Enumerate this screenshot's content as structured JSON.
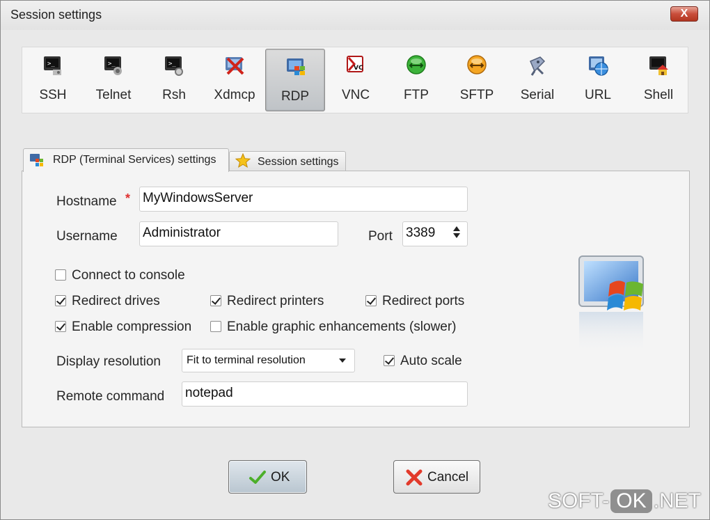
{
  "window": {
    "title": "Session settings",
    "close_label": "X"
  },
  "session_types": [
    {
      "label": "SSH",
      "icon": "ssh-terminal-icon"
    },
    {
      "label": "Telnet",
      "icon": "telnet-terminal-icon"
    },
    {
      "label": "Rsh",
      "icon": "rsh-terminal-icon"
    },
    {
      "label": "Xdmcp",
      "icon": "xdmcp-icon"
    },
    {
      "label": "RDP",
      "icon": "rdp-windows-icon",
      "selected": true
    },
    {
      "label": "VNC",
      "icon": "vnc-icon"
    },
    {
      "label": "FTP",
      "icon": "ftp-globe-icon"
    },
    {
      "label": "SFTP",
      "icon": "sftp-globe-icon"
    },
    {
      "label": "Serial",
      "icon": "serial-plug-icon"
    },
    {
      "label": "URL",
      "icon": "url-globe-icon"
    },
    {
      "label": "Shell",
      "icon": "shell-home-icon"
    }
  ],
  "tabs": [
    {
      "label": "RDP (Terminal Services) settings",
      "icon": "windows-flag-icon",
      "active": true
    },
    {
      "label": "Session settings",
      "icon": "star-icon",
      "active": false
    }
  ],
  "form": {
    "hostname_label": "Hostname",
    "required_marker": "*",
    "hostname_value": "MyWindowsServer",
    "username_label": "Username",
    "username_value": "Administrator",
    "port_label": "Port",
    "port_value": "3389",
    "display_resolution_label": "Display resolution",
    "display_resolution_value": "Fit to terminal resolution",
    "remote_command_label": "Remote command",
    "remote_command_value": "notepad"
  },
  "checkboxes": {
    "connect_console": {
      "label": "Connect to console",
      "checked": false
    },
    "redirect_drives": {
      "label": "Redirect drives",
      "checked": true
    },
    "redirect_printers": {
      "label": "Redirect printers",
      "checked": true
    },
    "redirect_ports": {
      "label": "Redirect ports",
      "checked": true
    },
    "enable_compression": {
      "label": "Enable compression",
      "checked": true
    },
    "graphic_enhancements": {
      "label": "Enable graphic enhancements (slower)",
      "checked": false
    },
    "auto_scale": {
      "label": "Auto scale",
      "checked": true
    }
  },
  "buttons": {
    "ok_label": "OK",
    "cancel_label": "Cancel"
  },
  "watermark": {
    "left": "SOFT-",
    "box": "OK",
    "right": ".NET"
  },
  "colors": {
    "close_button": "#c94e3b",
    "required": "#e03131",
    "ok_check": "#4caf2a",
    "cancel_x": "#e23a2b"
  }
}
